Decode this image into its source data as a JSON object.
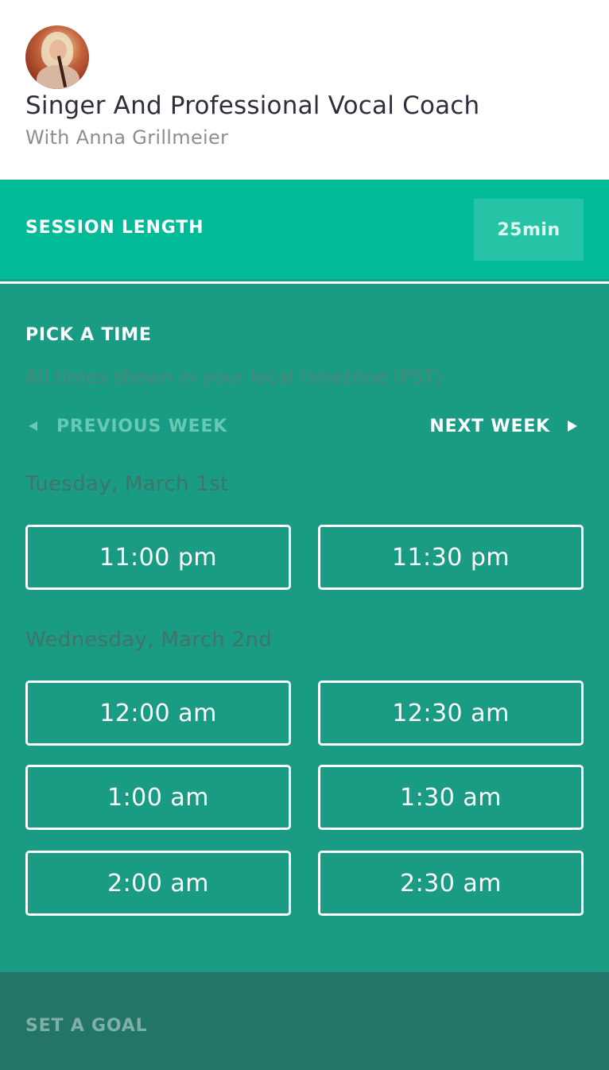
{
  "header": {
    "title": "Singer And Professional Vocal Coach",
    "subtitle": "With Anna Grillmeier"
  },
  "session": {
    "label": "SESSION LENGTH",
    "value": "25min"
  },
  "pick_time": {
    "heading": "PICK A TIME",
    "timezone_note": "All times shown in your local timezone (PST)",
    "previous_week": "PREVIOUS WEEK",
    "next_week": "NEXT WEEK",
    "days": [
      {
        "label": "Tuesday, March 1st",
        "slots": [
          "11:00 pm",
          "11:30 pm"
        ]
      },
      {
        "label": "Wednesday, March 2nd",
        "slots": [
          "12:00 am",
          "12:30 am",
          "1:00 am",
          "1:30 am",
          "2:00 am",
          "2:30 am"
        ]
      }
    ]
  },
  "goal": {
    "label": "SET A GOAL"
  },
  "colors": {
    "session_bar": "#00ba98",
    "pick_bg": "#199c83",
    "goal_bg": "#237568",
    "title_text": "#2e2f3e"
  }
}
